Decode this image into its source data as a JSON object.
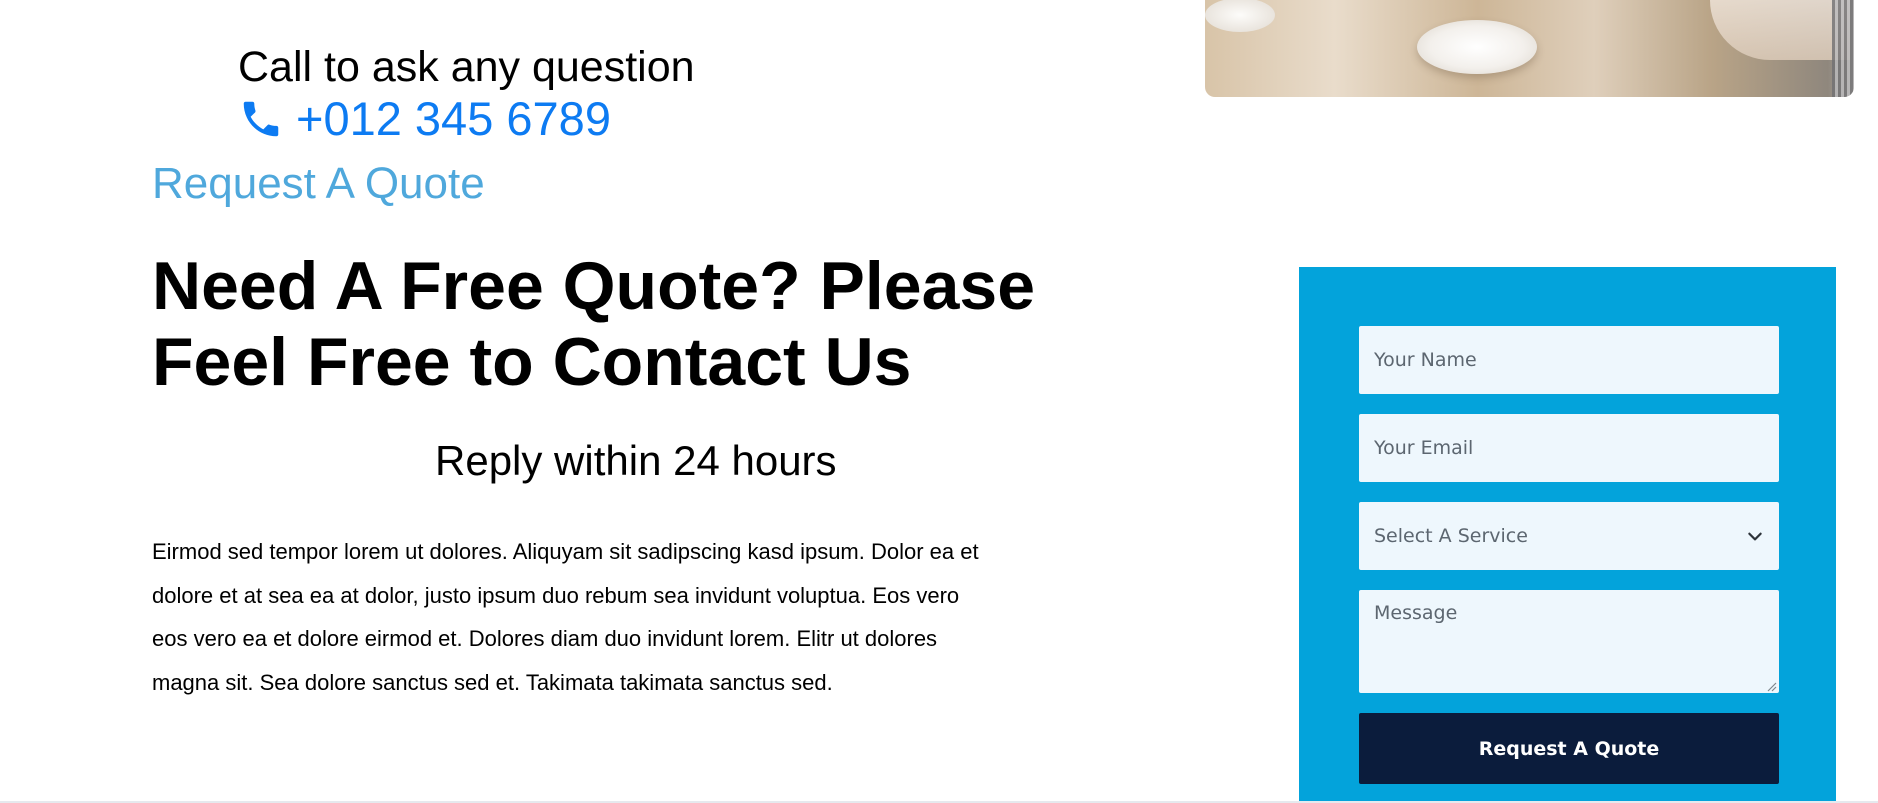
{
  "contact": {
    "call_label": "Call to ask any question",
    "phone_number": "+012 345 6789",
    "phone_icon": "phone-icon",
    "accent_color": "#0d7bf2"
  },
  "section": {
    "eyebrow": "Request A Quote",
    "heading": "Need A Free Quote? Please Feel Free to Contact Us",
    "reply_note": "Reply within 24 hours",
    "description": "Eirmod sed tempor lorem ut dolores. Aliquyam sit sadipscing kasd ipsum. Dolor ea et dolore et at sea ea at dolor, justo ipsum duo rebum sea invidunt voluptua. Eos vero eos vero ea et dolore eirmod et. Dolores diam duo invidunt lorem. Elitr ut dolores magna sit. Sea dolore sanctus sed et. Takimata takimata sanctus sed."
  },
  "quote_form": {
    "panel_color": "#03a3db",
    "name_placeholder": "Your Name",
    "email_placeholder": "Your Email",
    "service_select": {
      "selected": "Select A Service",
      "icon": "chevron-down-icon"
    },
    "message_placeholder": "Message",
    "submit_label": "Request A Quote",
    "submit_color": "#0b1c3c"
  }
}
